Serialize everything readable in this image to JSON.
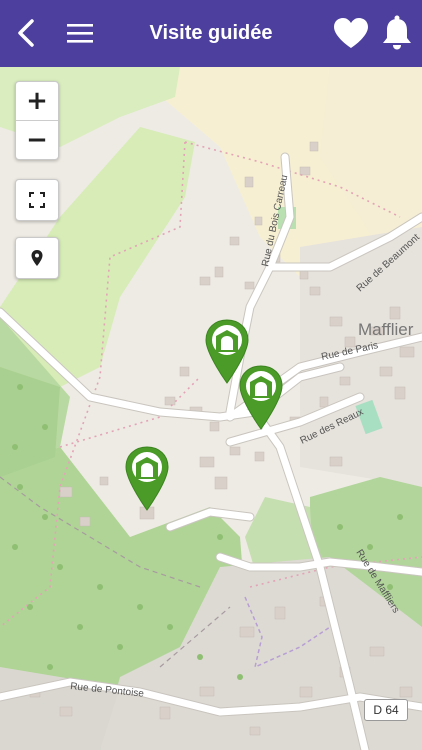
{
  "header": {
    "title": "Visite guidée",
    "back_icon": "chevron-left-icon",
    "menu_icon": "hamburger-icon",
    "favorite_icon": "heart-icon",
    "notification_icon": "bell-icon",
    "bar_color": "#4c3f9d"
  },
  "map_controls": {
    "zoom_in": "+",
    "zoom_out": "−",
    "fullscreen_icon": "fullscreen-icon",
    "locate_icon": "location-pin-icon"
  },
  "map": {
    "place_label": "Mafflier",
    "road_badge": "D 64",
    "streets": [
      "Rue du Bois Carreau",
      "Rue de Beaumont",
      "Rue de Paris",
      "Rue des Reaux",
      "Rue de Maffliers",
      "Rue de Pontoise"
    ],
    "marker_color": "#4a9b28",
    "marker_icon": "monument-gate-icon"
  }
}
